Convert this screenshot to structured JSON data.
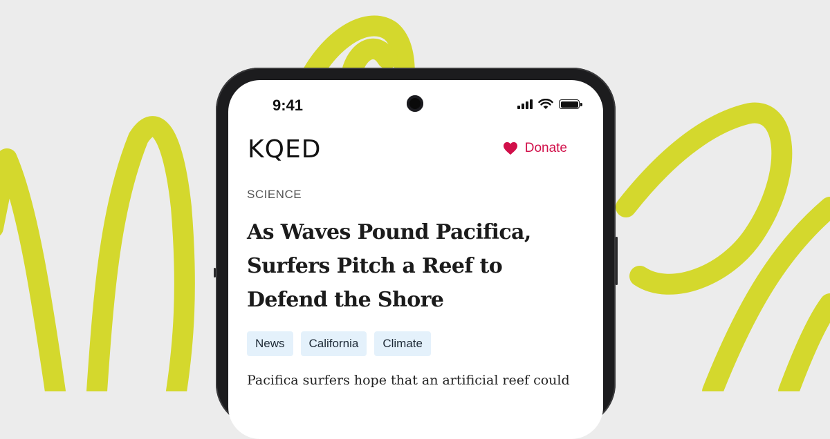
{
  "status_bar": {
    "time": "9:41"
  },
  "header": {
    "logo": "KQED",
    "donate_label": "Donate"
  },
  "article": {
    "category": "SCIENCE",
    "headline": "As Waves Pound Pacifica, Surfers Pitch a Reef to Defend the Shore",
    "tags": [
      "News",
      "California",
      "Climate"
    ],
    "lede": "Pacifica surfers hope that an artificial reef could"
  },
  "colors": {
    "background": "#ececec",
    "scribble": "#d4d82d",
    "accent": "#d1104a",
    "tag_bg": "#e4f1fb"
  }
}
